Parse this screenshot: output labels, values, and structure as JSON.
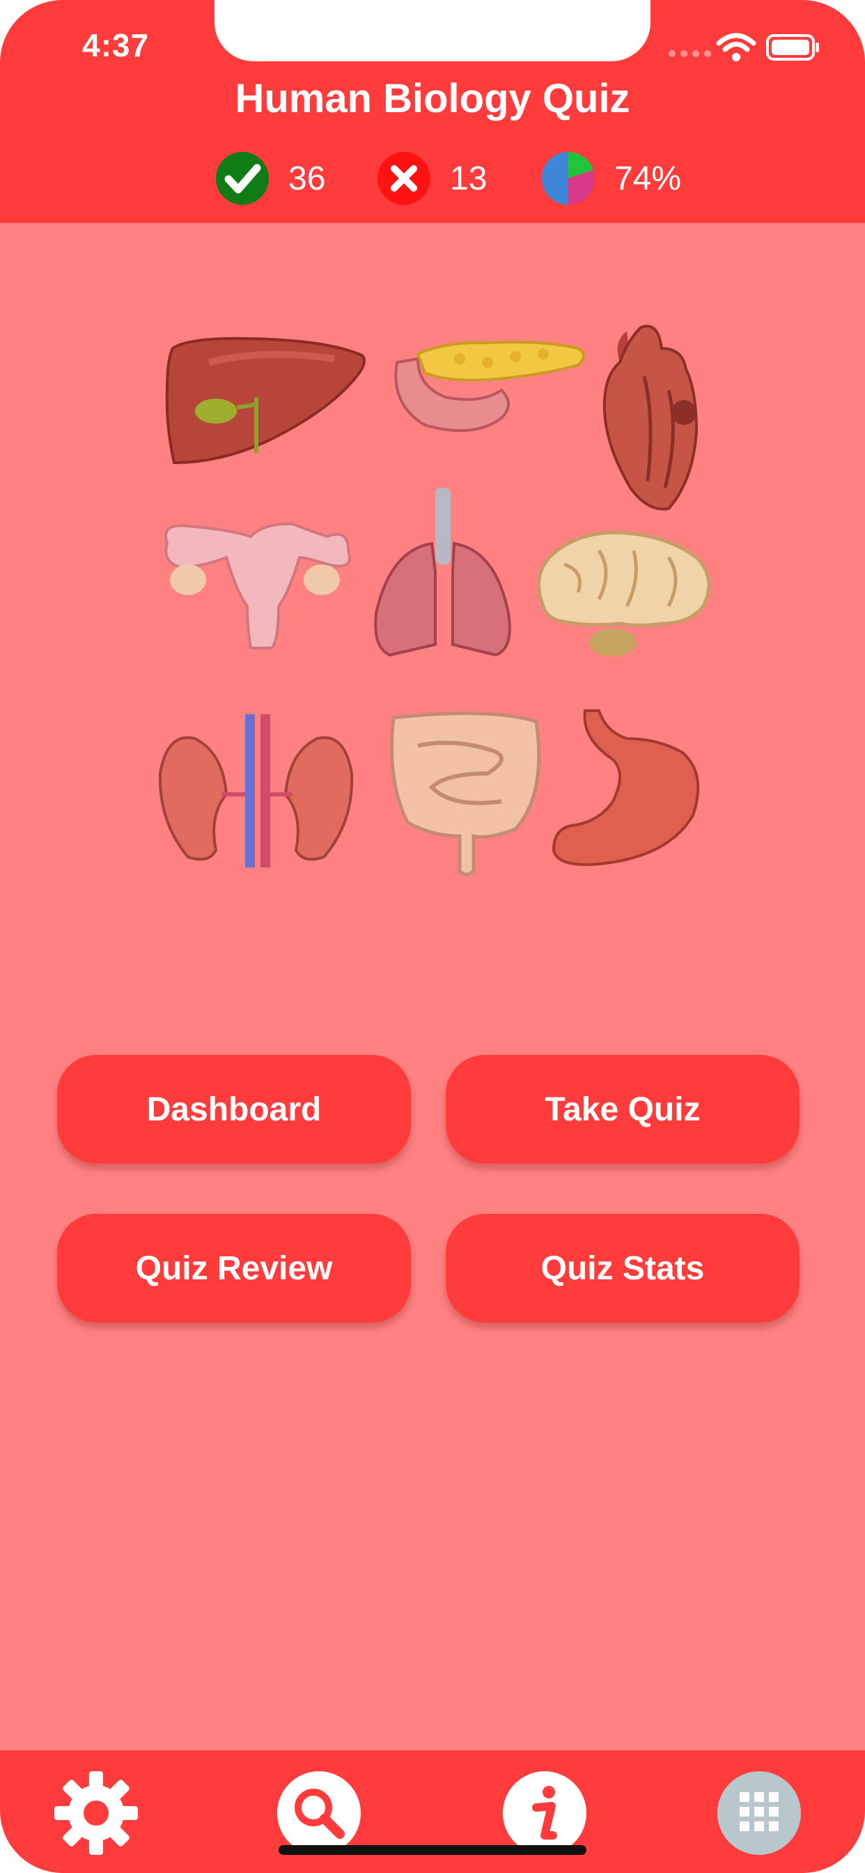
{
  "status_bar": {
    "time": "4:37"
  },
  "header": {
    "title": "Human Biology Quiz",
    "stats": {
      "correct": "36",
      "wrong": "13",
      "percentage": "74%"
    }
  },
  "organs": [
    "liver",
    "pancreas",
    "heart",
    "uterus",
    "lungs",
    "brain",
    "kidneys",
    "intestines",
    "stomach"
  ],
  "buttons": {
    "dashboard": "Dashboard",
    "take_quiz": "Take Quiz",
    "quiz_review": "Quiz Review",
    "quiz_stats": "Quiz Stats"
  },
  "tabbar": {
    "icons": [
      "gear-icon",
      "search-icon",
      "info-icon",
      "grid-icon"
    ]
  },
  "colors": {
    "primary": "#ff3b3b",
    "background": "#ff8181",
    "correct": "#1a8a1a",
    "wrong": "#ff1f1f"
  }
}
